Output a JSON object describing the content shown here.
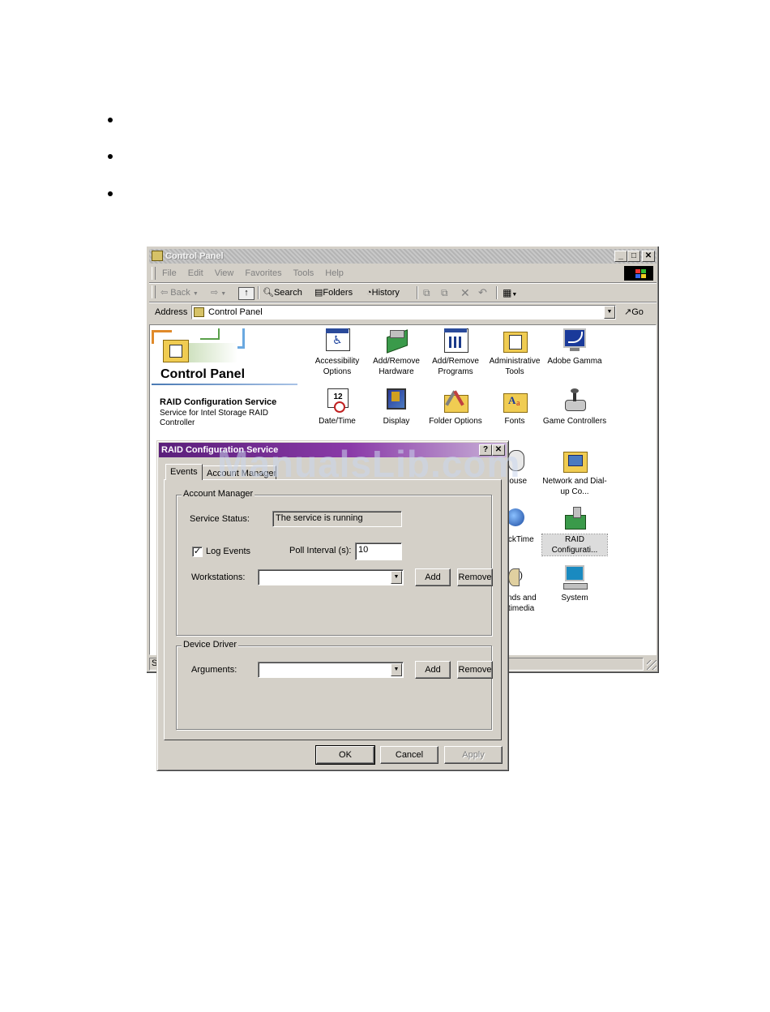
{
  "cp_window": {
    "title": "Control Panel",
    "caption_buttons": [
      "_",
      "□",
      "✕"
    ],
    "menu": [
      "File",
      "Edit",
      "View",
      "Favorites",
      "Tools",
      "Help"
    ],
    "toolbar": {
      "back": "Back",
      "search": "Search",
      "folders": "Folders",
      "history": "History"
    },
    "address": {
      "label": "Address",
      "value": "Control Panel",
      "go": "Go"
    },
    "left_pane": {
      "title": "Control Panel",
      "selected_title": "RAID Configuration Service",
      "selected_desc": "Service for Intel Storage RAID Controller"
    },
    "items": [
      {
        "label": "Accessibility Options",
        "icon": "accessibility-icon"
      },
      {
        "label": "Add/Remove Hardware",
        "icon": "hardware-icon"
      },
      {
        "label": "Add/Remove Programs",
        "icon": "programs-icon"
      },
      {
        "label": "Administrative Tools",
        "icon": "admin-tools-icon"
      },
      {
        "label": "Adobe Gamma",
        "icon": "adobe-gamma-icon"
      },
      {
        "label": "Date/Time",
        "icon": "calendar-icon"
      },
      {
        "label": "Display",
        "icon": "display-icon"
      },
      {
        "label": "Folder Options",
        "icon": "folder-options-icon"
      },
      {
        "label": "Fonts",
        "icon": "fonts-icon"
      },
      {
        "label": "Game Controllers",
        "icon": "joystick-icon"
      },
      {
        "label": "Mouse",
        "icon": "mouse-icon"
      },
      {
        "label": "Network and Dial-up Co...",
        "icon": "network-icon"
      },
      {
        "label": "QuickTime",
        "icon": "quicktime-icon"
      },
      {
        "label": "RAID Configurati...",
        "icon": "raid-icon"
      },
      {
        "label": "Sounds and Multimedia",
        "icon": "speaker-icon"
      },
      {
        "label": "System",
        "icon": "computer-icon"
      }
    ],
    "status_text": "Se"
  },
  "dialog": {
    "title": "RAID Configuration Service",
    "help_button": "?",
    "close_button": "✕",
    "tabs": [
      "Events",
      "Account Manager"
    ],
    "account_group": {
      "legend": "Account Manager",
      "service_status_label": "Service Status:",
      "service_status_value": "The service is running",
      "log_events_label": "Log Events",
      "log_events_checked": "✓",
      "poll_label": "Poll Interval (s):",
      "poll_value": "10",
      "workstations_label": "Workstations:",
      "add": "Add",
      "remove": "Remove"
    },
    "driver_group": {
      "legend": "Device Driver",
      "arguments_label": "Arguments:",
      "add": "Add",
      "remove": "Remove"
    },
    "buttons": {
      "ok": "OK",
      "cancel": "Cancel",
      "apply": "Apply"
    }
  },
  "watermark": "ManualsLib.com"
}
